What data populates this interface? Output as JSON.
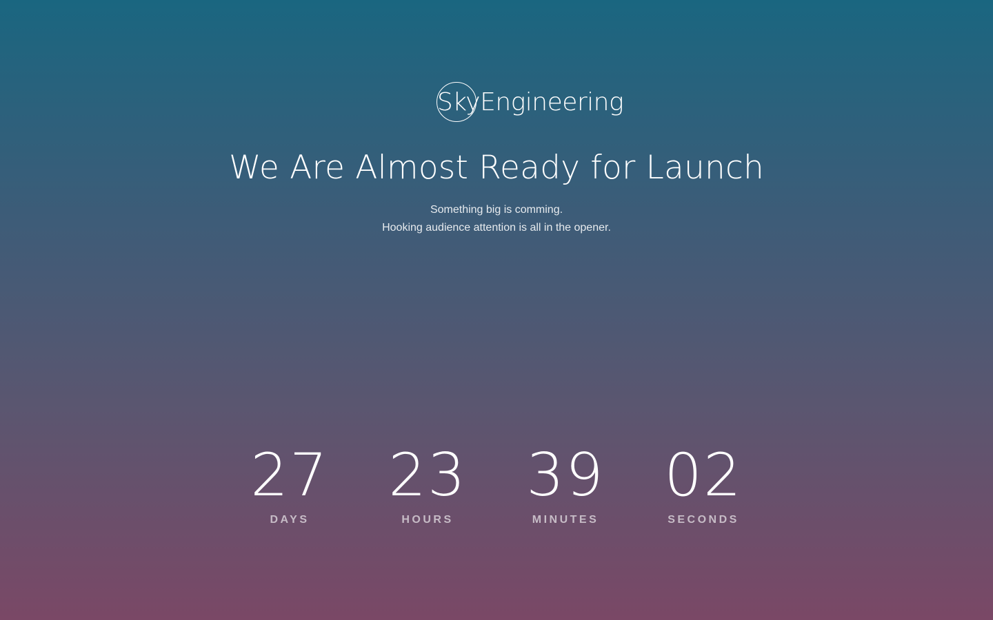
{
  "brand": {
    "name": "SkyEngineering"
  },
  "hero": {
    "headline": "We Are Almost Ready for Launch",
    "subtitle_line1": "Something big is comming.",
    "subtitle_line2": "Hooking audience attention is all in the opener."
  },
  "countdown": {
    "units": [
      {
        "value": "27",
        "label": "DAYS"
      },
      {
        "value": "23",
        "label": "HOURS"
      },
      {
        "value": "39",
        "label": "MINUTES"
      },
      {
        "value": "02",
        "label": "SECONDS"
      }
    ]
  },
  "colors": {
    "gradient_top": "#1a6680",
    "gradient_bottom": "#7a4866",
    "text": "#ffffff"
  }
}
